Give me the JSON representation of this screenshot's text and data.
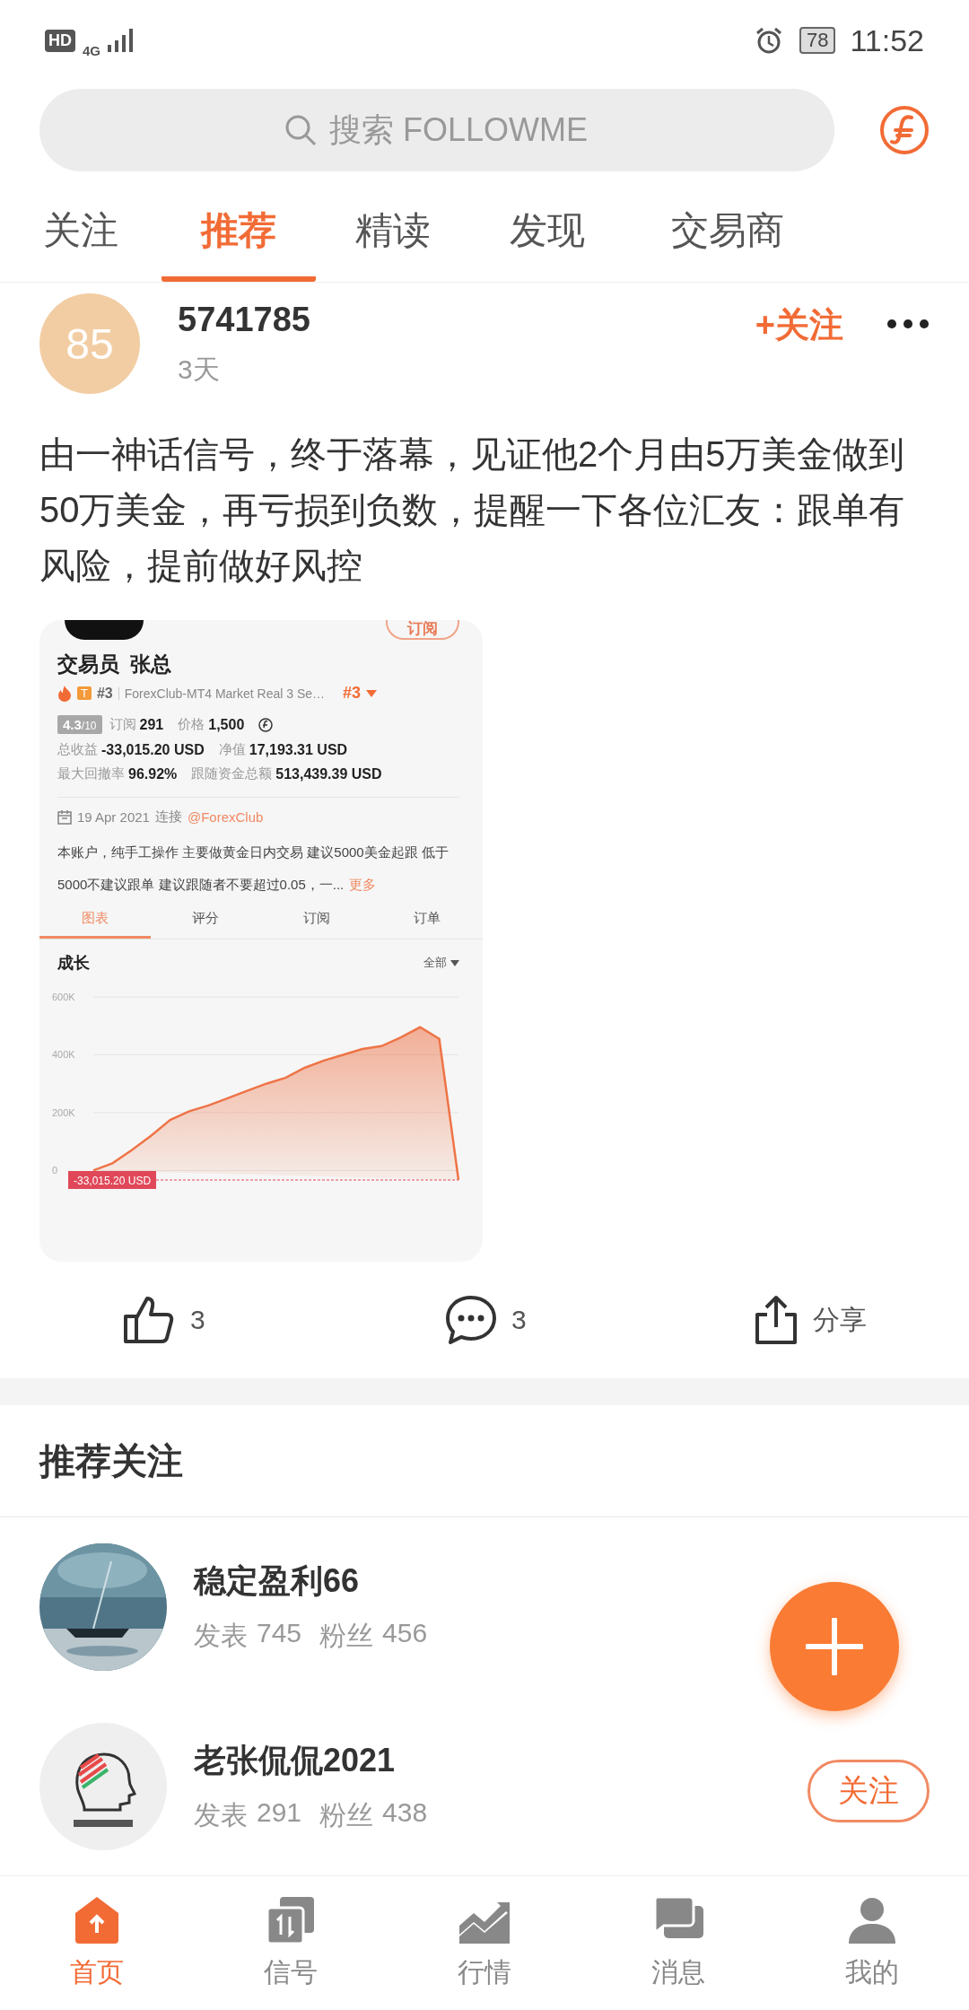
{
  "status_bar": {
    "hd": "HD",
    "network": "4G",
    "battery": "78",
    "time": "11:52"
  },
  "search": {
    "placeholder": "搜索 FOLLOWME"
  },
  "tabs": [
    {
      "label": "关注",
      "selected": false
    },
    {
      "label": "推荐",
      "selected": true
    },
    {
      "label": "精读",
      "selected": false
    },
    {
      "label": "发现",
      "selected": false
    },
    {
      "label": "交易商",
      "selected": false
    }
  ],
  "post": {
    "avatar_text": "85",
    "author": "5741785",
    "time": "3天",
    "follow": "+关注",
    "text": "由一神话信号，终于落幕，见证他2个月由5万美金做到50万美金，再亏损到负数，提醒一下各位汇友：跟单有风险，提前做好风控",
    "embed": {
      "subscribe": "订阅",
      "trader_label": "交易员",
      "trader_name": "张总",
      "badge": "T",
      "rank": "#3",
      "server": "ForexClub-MT4 Market Real 3 Se…",
      "rank_right": "#3",
      "score": "4.3",
      "score_max": "/10",
      "stat_rows": [
        [
          {
            "label": "订阅",
            "value": "291"
          },
          {
            "label": "价格",
            "value": "1,500",
            "coin": true
          }
        ],
        [
          {
            "label": "总收益",
            "value": "-33,015.20 USD"
          },
          {
            "label": "净值",
            "value": "17,193.31 USD"
          }
        ],
        [
          {
            "label": "最大回撤率",
            "value": "96.92%"
          },
          {
            "label": "跟随资金总额",
            "value": "513,439.39 USD"
          }
        ]
      ],
      "date": "19 Apr 2021",
      "connect": "连接",
      "broker": "@ForexClub",
      "desc": "本账户，纯手工操作 主要做黄金日内交易 建议5000美金起跟 低于5000不建议跟单 建议跟随者不要超过0.05，一...",
      "more": "更多",
      "tabs": [
        {
          "label": "图表",
          "selected": true
        },
        {
          "label": "评分",
          "selected": false
        },
        {
          "label": "订阅",
          "selected": false
        },
        {
          "label": "订单",
          "selected": false
        }
      ],
      "range": "全部",
      "chart_data": {
        "type": "area",
        "title": "成长",
        "grid": true,
        "ylim": [
          -33000,
          600000
        ],
        "yticks": [
          {
            "value": 0,
            "label": "0"
          },
          {
            "value": 200000,
            "label": "200K"
          },
          {
            "value": 400000,
            "label": "400K"
          },
          {
            "value": 600000,
            "label": "600K"
          }
        ],
        "series": [
          {
            "color": "#ee7447",
            "values": [
              0,
              25000,
              70000,
              120000,
              175000,
              205000,
              225000,
              250000,
              275000,
              300000,
              320000,
              355000,
              380000,
              400000,
              420000,
              430000,
              460000,
              495000,
              455000,
              -33000
            ]
          }
        ],
        "annotations": [
          "-33,015.20 USD"
        ]
      }
    },
    "actions": [
      {
        "kind": "like",
        "label": "3"
      },
      {
        "kind": "comment",
        "label": "3"
      },
      {
        "kind": "share",
        "label": "分享"
      }
    ]
  },
  "recommend": {
    "title": "推荐关注",
    "users": [
      {
        "name": "稳定盈利66",
        "posts_label": "发表",
        "posts": "745",
        "fans_label": "粉丝",
        "fans": "456",
        "kind": "picture"
      },
      {
        "name": "老张侃侃2021",
        "posts_label": "发表",
        "posts": "291",
        "fans_label": "粉丝",
        "fans": "438",
        "follow": "关注",
        "kind": "picture"
      }
    ]
  },
  "bottom_nav": [
    {
      "kind": "home",
      "label": "首页",
      "selected": true
    },
    {
      "kind": "signal",
      "label": "信号",
      "selected": false
    },
    {
      "kind": "market",
      "label": "行情",
      "selected": false
    },
    {
      "kind": "message",
      "label": "消息",
      "selected": false
    },
    {
      "kind": "profile",
      "label": "我的",
      "selected": false
    }
  ]
}
